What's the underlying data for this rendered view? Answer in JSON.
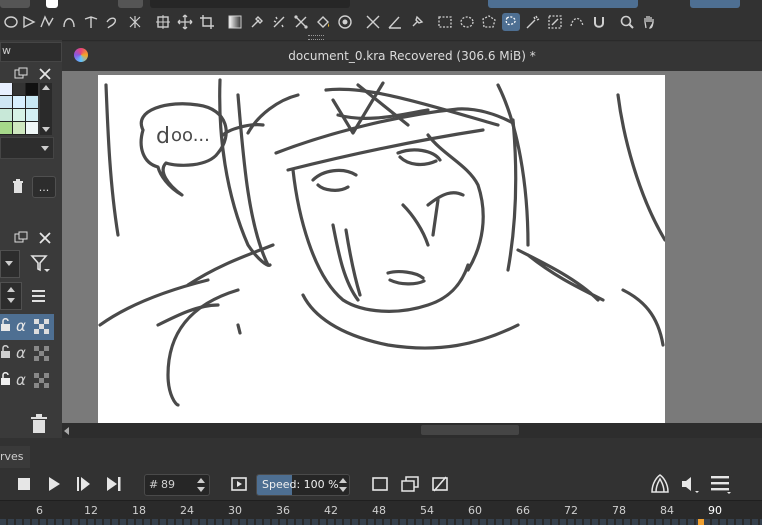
{
  "document": {
    "title": "document_0.kra Recovered (306.6 MiB) *"
  },
  "left_panel": {
    "tab_fragment": "w",
    "more_button": "..."
  },
  "animation": {
    "curves_tab": "rves",
    "frame_prefix": "#",
    "current_frame": "89",
    "speed_label": "Speed",
    "speed_value": ": 100 %",
    "speed_fraction": 0.38
  },
  "timeline": {
    "ticks": [
      "6",
      "12",
      "18",
      "24",
      "30",
      "36",
      "42",
      "48",
      "54",
      "60",
      "66",
      "72",
      "78",
      "84",
      "90"
    ],
    "playhead_frame": "90"
  },
  "colors": {
    "accent": "#4e6f92",
    "canvas": "#ffffff",
    "stroke": "#4a4a4a",
    "playhead": "#f0a030"
  },
  "icons": [
    "stop-icon",
    "play-icon",
    "next-frame-icon",
    "last-frame-icon",
    "loop-icon",
    "onion-skin-icon",
    "audio-icon",
    "menu-icon",
    "trash-icon",
    "filter-icon"
  ]
}
